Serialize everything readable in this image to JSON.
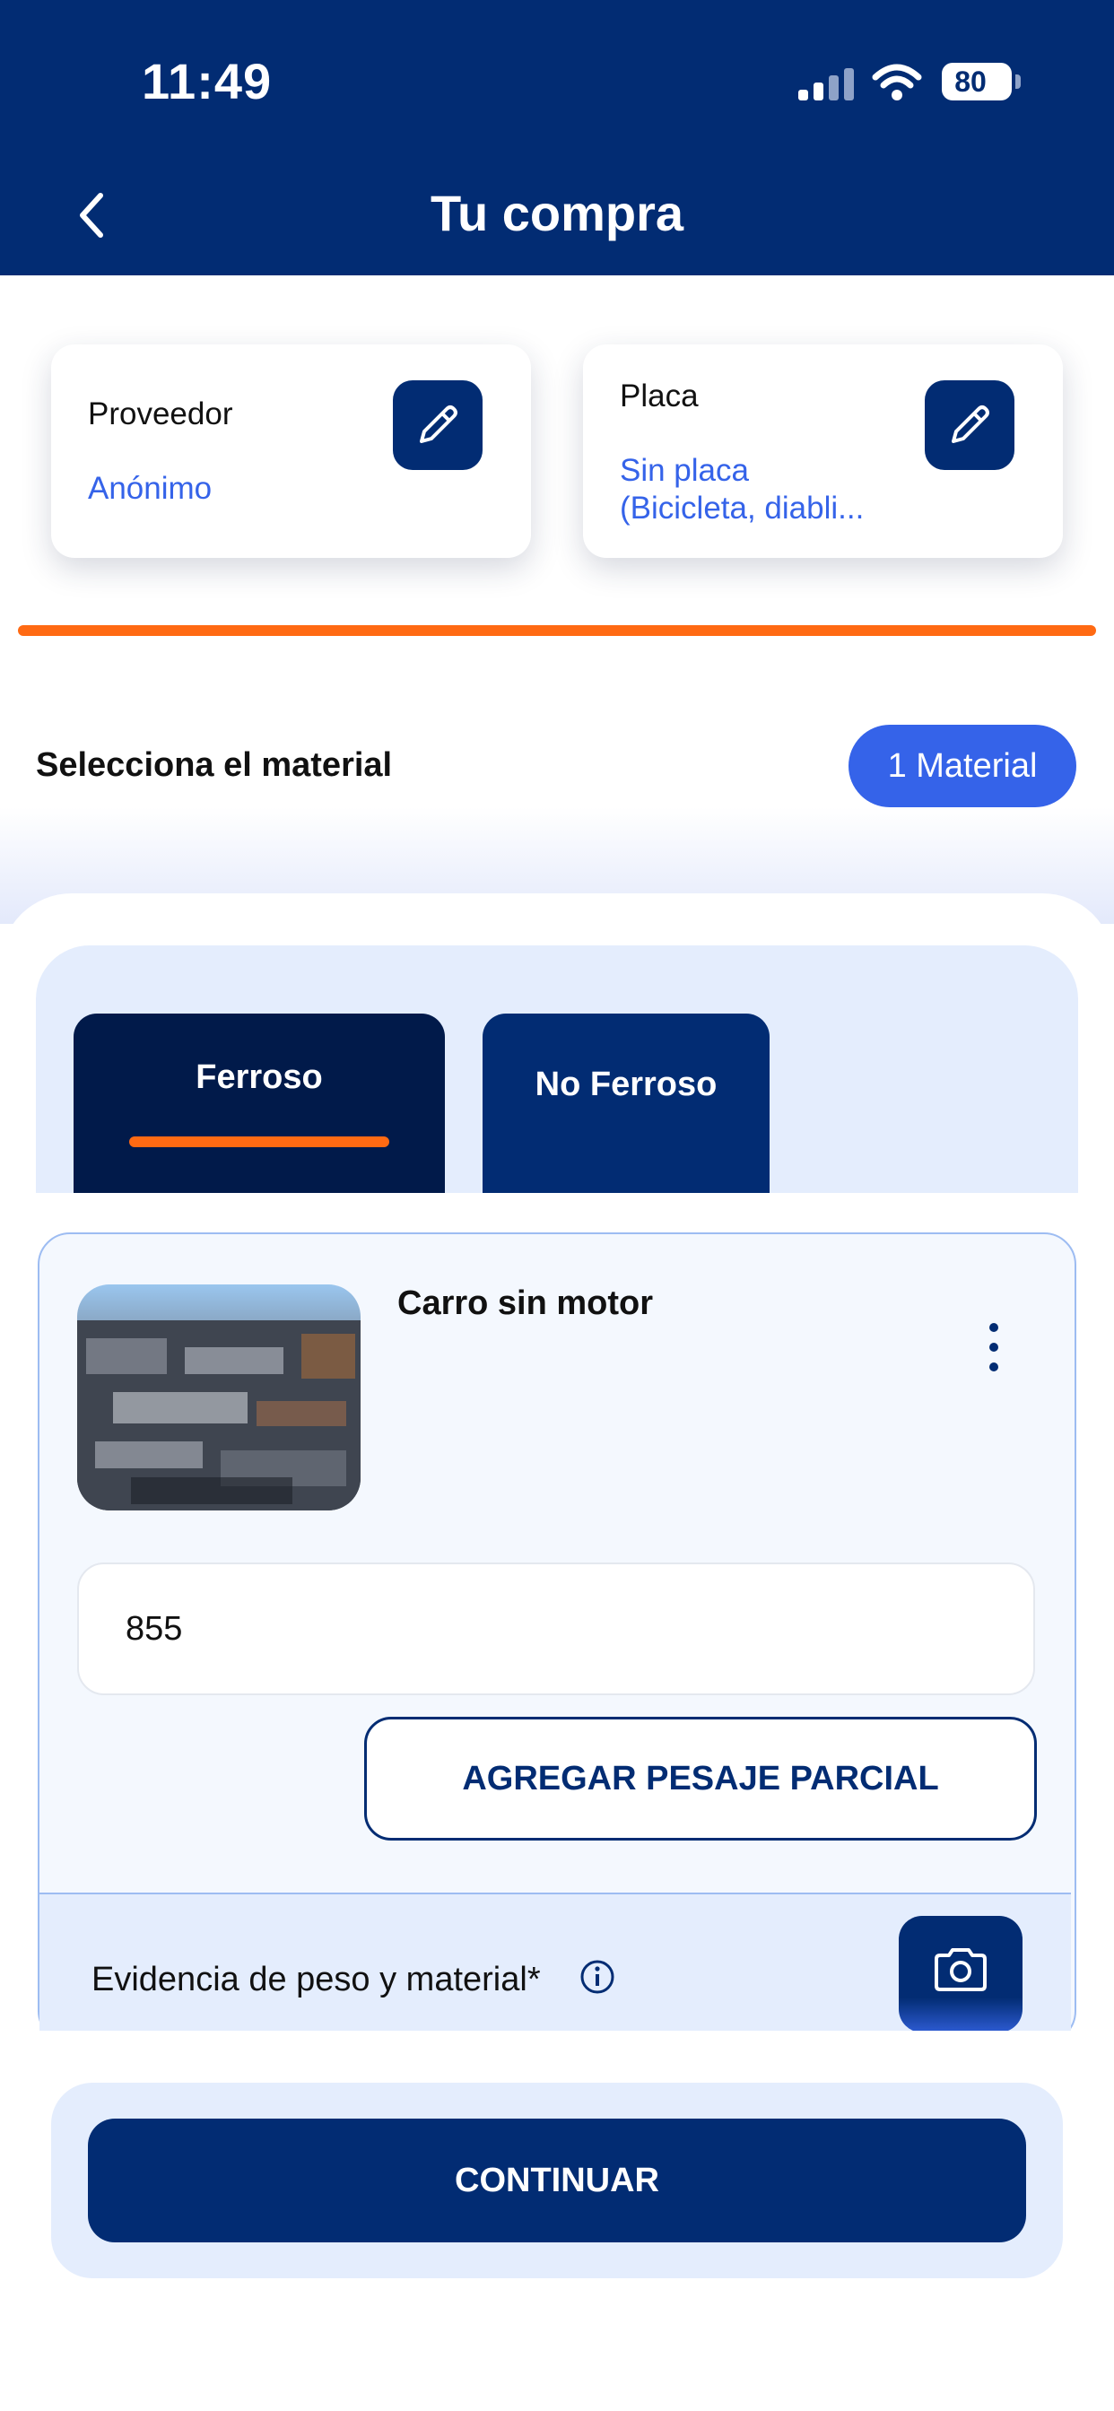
{
  "status_bar": {
    "time": "11:49",
    "battery": "80"
  },
  "header": {
    "title": "Tu compra"
  },
  "provider_card": {
    "label": "Proveedor",
    "value": "Anónimo"
  },
  "plate_card": {
    "label": "Placa",
    "value_line1": "Sin placa",
    "value_line2": "(Bicicleta, diabli..."
  },
  "material_section": {
    "label": "Selecciona el material",
    "count_badge": "1 Material"
  },
  "tabs": [
    {
      "label": "Ferroso",
      "active": true
    },
    {
      "label": "No Ferroso",
      "active": false
    }
  ],
  "material_item": {
    "name": "Carro sin motor",
    "weight_value": "855",
    "partial_button": "AGREGAR PESAJE PARCIAL",
    "evidence_label": "Evidencia de peso y material*"
  },
  "footer": {
    "continue_label": "CONTINUAR"
  },
  "colors": {
    "primary": "#022c73",
    "accent": "#ff6a13",
    "link": "#3563e9",
    "light_bg": "#e4edfd"
  }
}
